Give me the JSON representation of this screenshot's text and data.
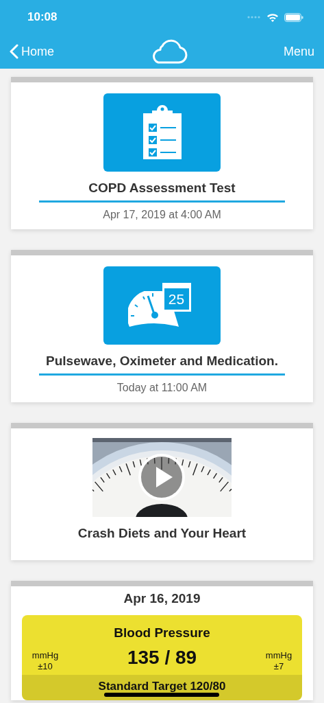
{
  "status_bar": {
    "time": "10:08"
  },
  "nav": {
    "back_label": "Home",
    "menu_label": "Menu"
  },
  "cards": [
    {
      "kind": "assessment",
      "title": "COPD Assessment Test",
      "subtitle": "Apr 17, 2019 at 4:00 AM"
    },
    {
      "kind": "reminder",
      "calendar_day": "25",
      "title": "Pulsewave, Oximeter and Medication.",
      "subtitle": "Today at 11:00 AM"
    },
    {
      "kind": "video",
      "title": "Crash Diets and Your Heart"
    },
    {
      "kind": "reading",
      "date": "Apr 16, 2019",
      "tile": {
        "title": "Blood Pressure",
        "value": "135 / 89",
        "left_unit": "mmHg",
        "left_tolerance": "±10",
        "right_unit": "mmHg",
        "right_tolerance": "±7",
        "target": "Standard Target 120/80",
        "color": "#ece030"
      }
    }
  ]
}
